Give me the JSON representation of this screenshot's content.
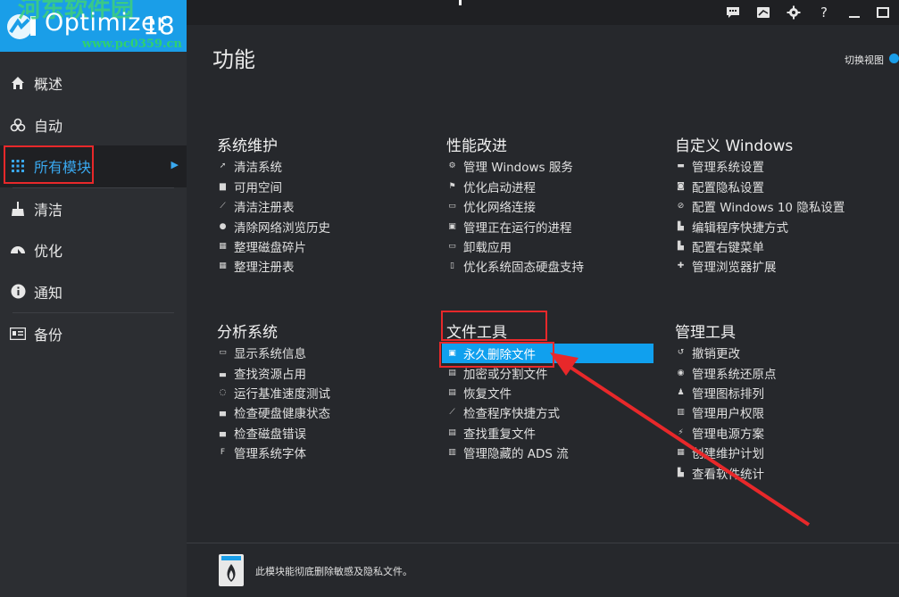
{
  "app": {
    "name": "Optimizer",
    "version": "18",
    "watermark_top": "河东软件园",
    "watermark_url": "www.pc0359.cn"
  },
  "sidebar": {
    "items": [
      {
        "label": "概述",
        "icon": "home-icon"
      },
      {
        "label": "自动",
        "icon": "biohazard-icon"
      },
      {
        "label": "所有模块",
        "icon": "grid-dots-icon",
        "active": true
      },
      {
        "label": "清洁",
        "icon": "broom-icon"
      },
      {
        "label": "优化",
        "icon": "gauge-icon"
      },
      {
        "label": "通知",
        "icon": "info-icon"
      },
      {
        "label": "备份",
        "icon": "backup-card-icon"
      }
    ]
  },
  "topbar": {
    "icons": [
      "feedback-icon",
      "news-icon",
      "settings-gear-icon",
      "help-question-icon",
      "minimize-icon",
      "maximize-icon"
    ],
    "help_label": "?"
  },
  "main": {
    "title": "功能",
    "switch_view_label": "切换视图",
    "sections": [
      {
        "title": "系统维护",
        "items": [
          "清洁系统",
          "可用空间",
          "清洁注册表",
          "清除网络浏览历史",
          "整理磁盘碎片",
          "整理注册表"
        ]
      },
      {
        "title": "性能改进",
        "items": [
          "管理 Windows 服务",
          "优化启动进程",
          "优化网络连接",
          "管理正在运行的进程",
          "卸载应用",
          "优化系统固态硬盘支持"
        ]
      },
      {
        "title": "自定义 Windows",
        "items": [
          "管理系统设置",
          "配置隐私设置",
          "配置 Windows 10 隐私设置",
          "编辑程序快捷方式",
          "配置右键菜单",
          "管理浏览器扩展"
        ]
      },
      {
        "title": "分析系统",
        "items": [
          "显示系统信息",
          "查找资源占用",
          "运行基准速度测试",
          "检查硬盘健康状态",
          "检查磁盘错误",
          "管理系统字体"
        ]
      },
      {
        "title": "文件工具",
        "items": [
          "永久删除文件",
          "加密或分割文件",
          "恢复文件",
          "检查程序快捷方式",
          "查找重复文件",
          "管理隐藏的 ADS 流"
        ],
        "selected_index": 0
      },
      {
        "title": "管理工具",
        "items": [
          "撤销更改",
          "管理系统还原点",
          "管理图标排列",
          "管理用户权限",
          "管理电源方案",
          "创建维护计划",
          "查看软件统计"
        ]
      }
    ]
  },
  "footer": {
    "description": "此模块能彻底删除敏感及隐私文件。",
    "icon": "shredder-bin-icon"
  },
  "colors": {
    "accent": "#1a9ee8",
    "sidebar_bg": "#2c2e32",
    "content_bg": "#26282c",
    "highlight_box": "#e8282a",
    "selected_item": "#10a0ee"
  }
}
